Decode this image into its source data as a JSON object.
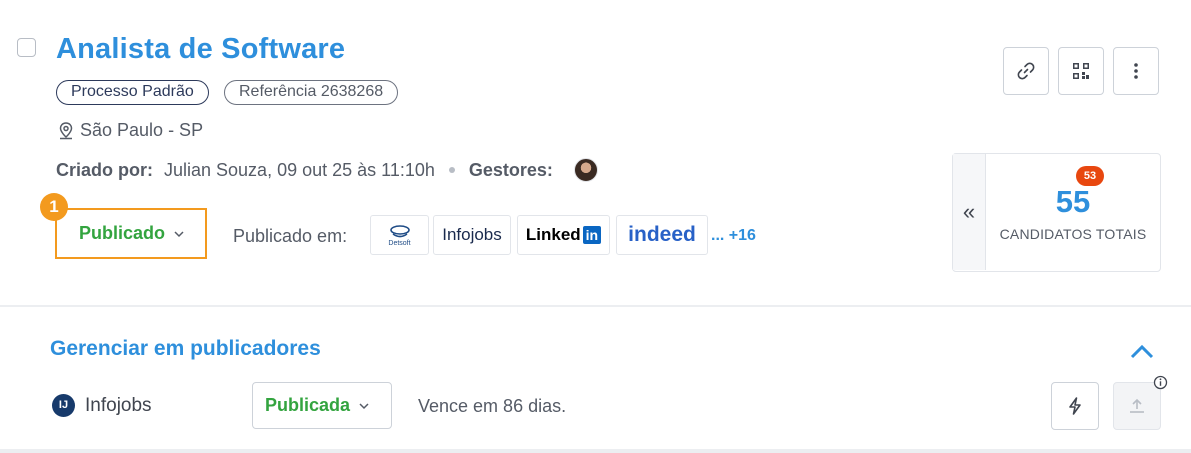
{
  "job": {
    "title": "Analista de Software",
    "tags": [
      "Processo Padrão",
      "Referência 2638268"
    ],
    "location": "São Paulo - SP",
    "created_by_label": "Criado por:",
    "created_by_value": "Julian Souza, 09 out 25 às 11:10h",
    "managers_label": "Gestores:"
  },
  "status": {
    "step_marker": "1",
    "value": "Publicado",
    "published_in_label": "Publicado em:",
    "publisher_logos": [
      "Detsoft",
      "Infojobs",
      "Linked",
      "in",
      "indeed"
    ],
    "more_link": "... +16"
  },
  "actions": {
    "icons": [
      "link-icon",
      "qr-code-icon",
      "more-vertical-icon"
    ]
  },
  "candidates": {
    "badge": "53",
    "count": "55",
    "label": "CANDIDATOS TOTAIS"
  },
  "publishers_section": {
    "title": "Gerenciar em publicadores",
    "rows": [
      {
        "logo_letters": "IJ",
        "name": "Infojobs",
        "status": "Publicada",
        "expiry": "Vence em 86 dias."
      }
    ]
  },
  "colors": {
    "accent": "#2e8fdc",
    "success": "#33a43f",
    "highlight": "#f39a1e",
    "badge": "#e8470f"
  }
}
